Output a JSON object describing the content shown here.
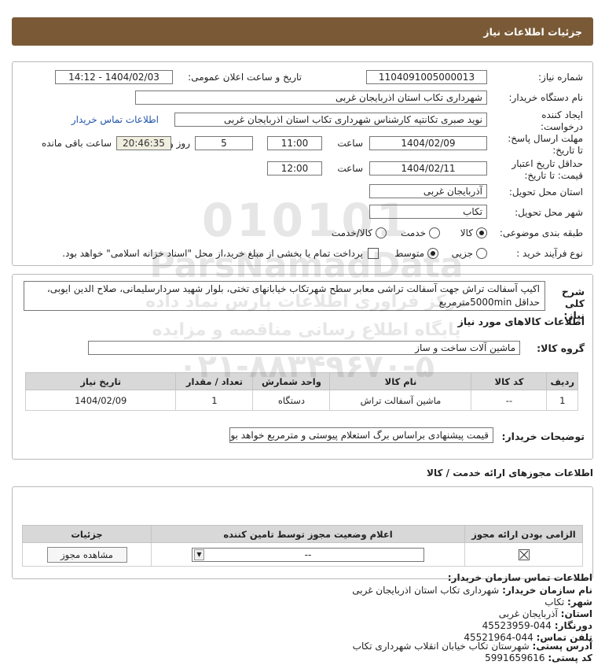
{
  "page_title": "جزئیات اطلاعات نیاز",
  "fields": {
    "need_number_label": "شماره نیاز:",
    "need_number": "1104091005000013",
    "announce_label": "تاریخ و ساعت اعلان عمومی:",
    "announce_value": "1404/02/03 - 14:12",
    "buyer_label": "نام دستگاه خریدار:",
    "buyer_value": "شهرداری تکاب استان اذربایجان غربی",
    "creator_label": "ایجاد کننده درخواست:",
    "creator_value": "نوید صبری تکانتپه کارشناس شهرداری تکاب استان اذربایجان غربی",
    "contact_link": "اطلاعات تماس خریدار",
    "reply_deadline_label": "مهلت ارسال پاسخ: تا تاریخ:",
    "reply_date": "1404/02/09",
    "time_label": "ساعت",
    "reply_time": "11:00",
    "days_value": "5",
    "days_label": "روز و",
    "remaining_time": "20:46:35",
    "remaining_label": "ساعت باقی مانده",
    "validity_label": "حداقل تاریخ اعتبار قیمت: تا تاریخ:",
    "validity_date": "1404/02/11",
    "validity_time": "12:00",
    "province_label": "استان محل تحویل:",
    "province_value": "آذربایجان غربی",
    "city_label": "شهر محل تحویل:",
    "city_value": "تکاب",
    "category_label": "طبقه بندی موضوعی:",
    "category_options": [
      "کالا",
      "خدمت",
      "کالا/خدمت"
    ],
    "category_selected": "کالا",
    "process_label": "نوع فرآیند خرید :",
    "process_options": [
      "جزیی",
      "متوسط"
    ],
    "process_selected": "متوسط",
    "payment_note": "پرداخت تمام یا بخشی از مبلغ خرید،از محل \"اسناد خزانه اسلامی\" خواهد بود."
  },
  "description": {
    "label": "شرح کلی نیاز:",
    "text": "اکیپ آسفالت تراش جهت آسفالت تراشی معابر سطح شهرتکاب خیابانهای تختی، بلوار شهید سردارسلیمانی، صلاح الدین ایوبی، حداقل 5000minمترمربع"
  },
  "goods": {
    "section_title": "اطلاعات کالاهای مورد نیاز",
    "group_label": "گروه کالا:",
    "group_value": "ماشین  آلات ساخت و ساز",
    "columns": [
      "ردیف",
      "کد کالا",
      "نام کالا",
      "واحد شمارش",
      "تعداد / مقدار",
      "تاریخ نیاز"
    ],
    "rows": [
      [
        "1",
        "--",
        "ماشین آسفالت تراش",
        "دستگاه",
        "1",
        "1404/02/09"
      ]
    ],
    "buyer_notes_label": "توضیحات خریدار:",
    "buyer_notes": "قیمت پیشنهادی براساس برگ استعلام پیوستی و مترمربع خواهد بود."
  },
  "permits": {
    "section_title": "اطلاعات مجوزهای ارائه خدمت / کالا",
    "columns": [
      "الزامی بودن ارائه مجوز",
      "اعلام وضعیت مجوز توسط تامین کننده",
      "جزئیات"
    ],
    "select_value": "--",
    "view_button": "مشاهده مجوز"
  },
  "contact": {
    "title": "اطلاعات تماس سازمان خریدار:",
    "org_label": "نام سازمان خریدار:",
    "org_value": "شهرداری تکاب استان اذربایجان غربی",
    "city_label": "شهر:",
    "city_value": "تکاب",
    "province_label": "استان:",
    "province_value": "آذربایجان غربی",
    "fax_label": "دورنگار:",
    "fax_value": "044-45523959",
    "phone_label": "تلفن تماس:",
    "phone_value": "044-45521964",
    "address_label": "آدرس پستی:",
    "address_value": "شهرستان تکاب خیابان انقلاب شهرداری تکاب",
    "postal_label": "کد پستی:",
    "postal_value": "5991659616"
  },
  "watermark": {
    "line1": "010101",
    "line2": "ParsNamadData",
    "line3": "مرکز فراوری اطلاعات پارس نماد داده",
    "line4": "پایگاه اطلاع رسانی مناقصه و مزایده",
    "line5": "۰۲۱-۸۸۳۴۹۶۷۰-۵"
  },
  "colors": {
    "title_bar": "#7a5a36",
    "table_header": "#d8d8d8",
    "link": "#2255aa"
  }
}
